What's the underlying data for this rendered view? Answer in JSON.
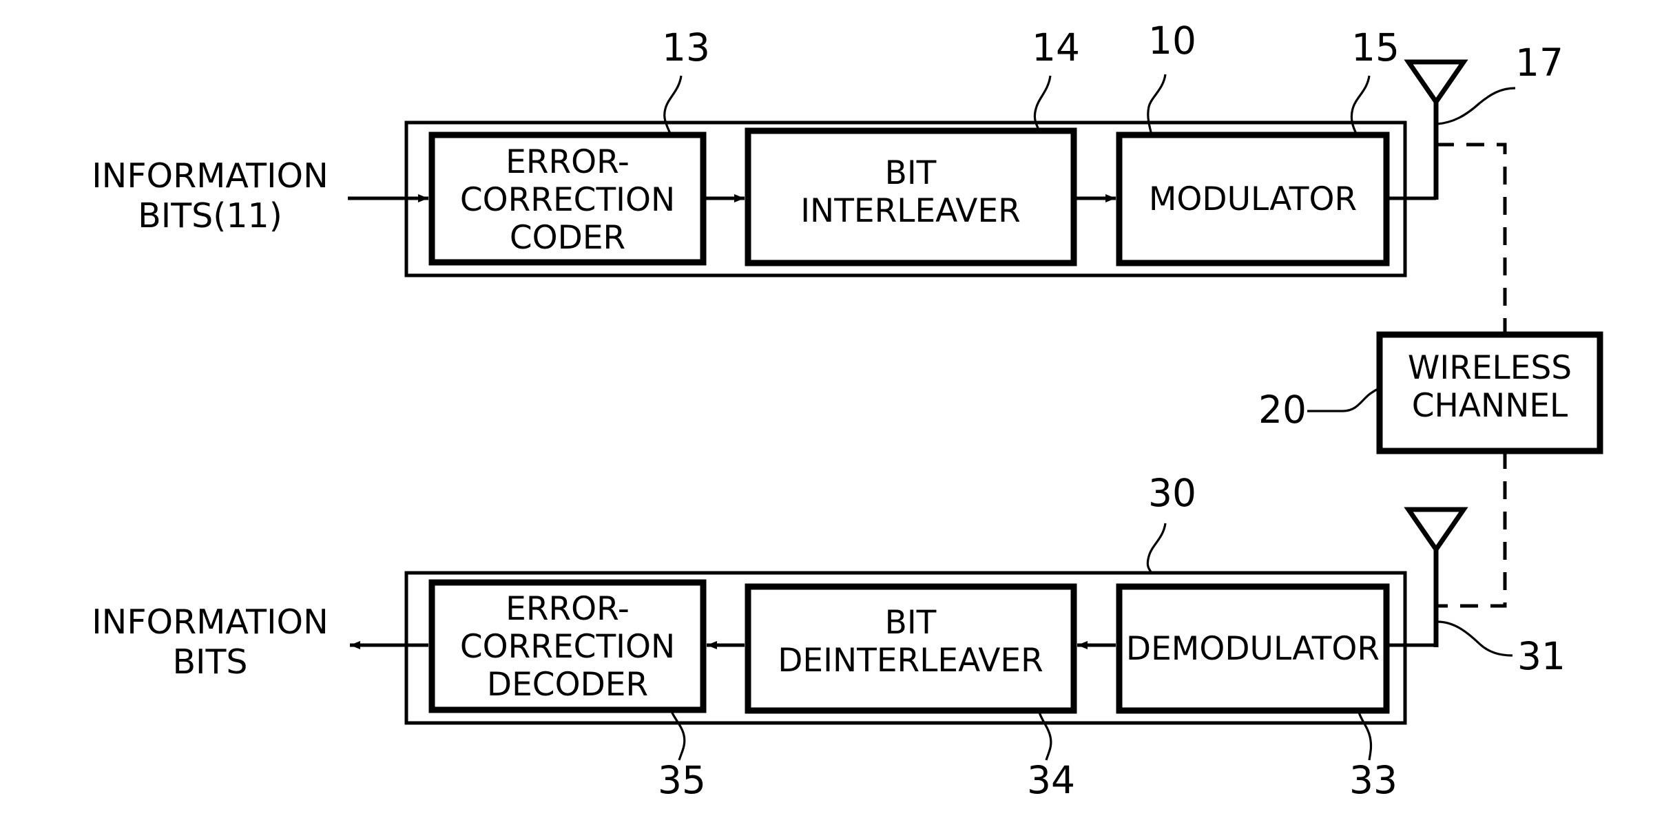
{
  "figure": {
    "type": "patent-block-diagram",
    "background": "#ffffff",
    "line_color": "#000000"
  },
  "transmitter": {
    "container_ref": "10",
    "blocks": [
      {
        "label_line1": "ERROR-",
        "label_line2": "CORRECTION",
        "label_line3": "CODER",
        "ref": "13"
      },
      {
        "label_line1": "BIT",
        "label_line2": "INTERLEAVER",
        "label_line3": "",
        "ref": "14"
      },
      {
        "label_line1": "MODULATOR",
        "label_line2": "",
        "label_line3": "",
        "ref": "15"
      }
    ],
    "input_label_line1": "INFORMATION",
    "input_label_line2": "BITS(11)",
    "antenna_ref": "17"
  },
  "channel": {
    "label_line1": "WIRELESS",
    "label_line2": "CHANNEL",
    "ref": "20"
  },
  "receiver": {
    "container_ref": "30",
    "blocks": [
      {
        "label_line1": "ERROR-",
        "label_line2": "CORRECTION",
        "label_line3": "DECODER",
        "ref": "35"
      },
      {
        "label_line1": "BIT",
        "label_line2": "DEINTERLEAVER",
        "label_line3": "",
        "ref": "34"
      },
      {
        "label_line1": "DEMODULATOR",
        "label_line2": "",
        "label_line3": "",
        "ref": "33"
      }
    ],
    "output_label_line1": "INFORMATION",
    "output_label_line2": "BITS",
    "antenna_ref": "31"
  }
}
